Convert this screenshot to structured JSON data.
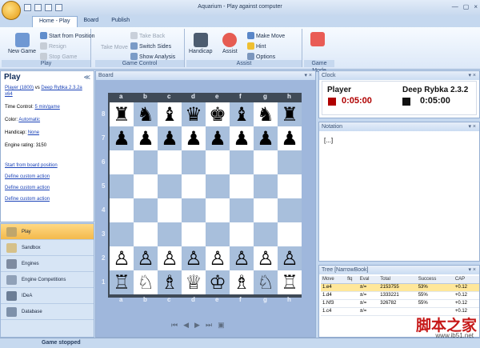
{
  "window": {
    "title": "Aquarium - Play against computer",
    "controls": [
      "—",
      "▢",
      "×"
    ]
  },
  "tabs": [
    "Home - Play",
    "Board",
    "Publish"
  ],
  "ribbon": {
    "new_game": "New Game",
    "play_group": "Play",
    "start_from_position": "Start from Position",
    "resign": "Resign",
    "stop_game": "Stop Game",
    "take_move": "Take Move",
    "take_back": "Take Back",
    "switch_sides": "Switch Sides",
    "show_analysis": "Show Analysis",
    "game_control": "Game Control",
    "handicap": "Handicap",
    "assist": "Assist",
    "make_move": "Make Move",
    "hint": "Hint",
    "options": "Options",
    "assist_group": "Assist",
    "game_mode": "Game Mode"
  },
  "left": {
    "title": "Play",
    "match_player": "Player (1800)",
    "match_vs": "vs",
    "match_engine": "Deep Rybka 2.3.2a x64",
    "time_control": "Time Control:",
    "time_value": "5 min/game",
    "color": "Color:",
    "color_value": "Automatic",
    "handicap": "Handicap:",
    "handicap_value": "None",
    "engine_rating": "Engine rating: 3150",
    "start_board": "Start from board position",
    "define1": "Define custom action",
    "define2": "Define custom action",
    "define3": "Define custom action"
  },
  "nav": [
    "Play",
    "Sandbox",
    "Engines",
    "Engine Competitions",
    "IDeA",
    "Database"
  ],
  "status": "Game stopped",
  "board": {
    "title": "Board",
    "files": [
      "a",
      "b",
      "c",
      "d",
      "e",
      "f",
      "g",
      "h"
    ],
    "ranks": [
      "8",
      "7",
      "6",
      "5",
      "4",
      "3",
      "2",
      "1"
    ],
    "pieces": [
      {
        "s": "a8",
        "p": "♜"
      },
      {
        "s": "b8",
        "p": "♞"
      },
      {
        "s": "c8",
        "p": "♝"
      },
      {
        "s": "d8",
        "p": "♛"
      },
      {
        "s": "e8",
        "p": "♚"
      },
      {
        "s": "f8",
        "p": "♝"
      },
      {
        "s": "g8",
        "p": "♞"
      },
      {
        "s": "h8",
        "p": "♜"
      },
      {
        "s": "a7",
        "p": "♟"
      },
      {
        "s": "b7",
        "p": "♟"
      },
      {
        "s": "c7",
        "p": "♟"
      },
      {
        "s": "d7",
        "p": "♟"
      },
      {
        "s": "e7",
        "p": "♟"
      },
      {
        "s": "f7",
        "p": "♟"
      },
      {
        "s": "g7",
        "p": "♟"
      },
      {
        "s": "h7",
        "p": "♟"
      },
      {
        "s": "a2",
        "p": "♙"
      },
      {
        "s": "b2",
        "p": "♙"
      },
      {
        "s": "c2",
        "p": "♙"
      },
      {
        "s": "d2",
        "p": "♙"
      },
      {
        "s": "e2",
        "p": "♙"
      },
      {
        "s": "f2",
        "p": "♙"
      },
      {
        "s": "g2",
        "p": "♙"
      },
      {
        "s": "h2",
        "p": "♙"
      },
      {
        "s": "a1",
        "p": "♖"
      },
      {
        "s": "b1",
        "p": "♘"
      },
      {
        "s": "c1",
        "p": "♗"
      },
      {
        "s": "d1",
        "p": "♕"
      },
      {
        "s": "e1",
        "p": "♔"
      },
      {
        "s": "f1",
        "p": "♗"
      },
      {
        "s": "g1",
        "p": "♘"
      },
      {
        "s": "h1",
        "p": "♖"
      }
    ]
  },
  "clock": {
    "title": "Clock",
    "player": "Player",
    "engine": "Deep Rybka 2.3.2",
    "player_time": "0:05:00",
    "engine_time": "0:05:00"
  },
  "notation": {
    "title": "Notation",
    "text": "[...]"
  },
  "tree": {
    "title": "Tree [NarrowBook]",
    "headers": [
      "Move",
      "flq",
      "Eval",
      "Total",
      "Success",
      "CAP"
    ],
    "rows": [
      [
        "1.e4",
        "",
        "±/=",
        "2153755",
        "53%",
        "+0.12"
      ],
      [
        "1.d4",
        "",
        "±/=",
        "1333221",
        "55%",
        "+0.12"
      ],
      [
        "1.Nf3",
        "",
        "±/=",
        "326782",
        "55%",
        "+0.12"
      ],
      [
        "1.c4",
        "",
        "±/=",
        "",
        "",
        "+0.12"
      ]
    ]
  },
  "watermark": {
    "title": "脚本之家",
    "url": "www.jb51.net"
  }
}
